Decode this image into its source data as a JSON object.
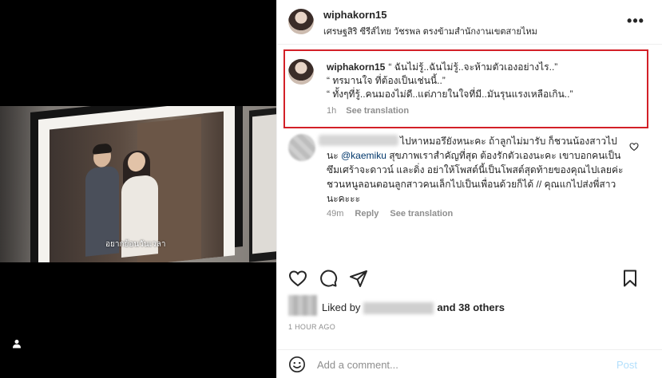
{
  "post": {
    "username": "wiphakorn15",
    "location": "เศรษฐสิริ ซีรีส์ไทย วัชรพล ตรงข้ามสำนักงานเขตสายไหม",
    "image_caption": "อยากย้อนวันเวลา"
  },
  "comments": [
    {
      "username": "wiphakorn15",
      "lines": [
        "“ ฉันไม่รู้..ฉันไม่รู้..จะห้ามตัวเองอย่างไร..”",
        "“ ทรมานใจ ที่ต้องเป็นเช่นนี้..”",
        "“ ทั้งๆที่รู้..คนมองไม่ดี..แต่ภายในใจที่มี..มันรุนแรงเหลือเกิน..”"
      ],
      "time": "1h",
      "see_translation": "See translation"
    },
    {
      "text_before_mention": "ไปหาหมอรึยังหนะคะ ถ้าลูกไม่มารับ ก็ชวนน้องสาวไปนะ",
      "mention": "@kaemiku",
      "text_after_mention": "สุขภาพเราสำคัญที่สุด ต้องรักตัวเองนะคะ เขาบอกคนเป็นซึมเศร้าจะดาวน์ และดิ่ง อย่าให้โพสต์นี้เป็นโพสต์สุดท้ายของคุณไปเลยค่ะ ชวนหนูลอนตอนลูกสาวคนเล็กไปเป็นเพื่อนด้วยก็ได้ // คุณแกไปส่งพี่สาวนะคะะะ",
      "time": "49m",
      "reply": "Reply",
      "see_translation": "See translation"
    }
  ],
  "likes": {
    "prefix": "Liked by",
    "others": "and 38 others"
  },
  "time_ago": "1 HOUR AGO",
  "add_comment": {
    "placeholder": "Add a comment...",
    "post_label": "Post"
  },
  "icons": [
    "more-icon",
    "heart-icon",
    "comment-icon",
    "share-icon",
    "bookmark-icon",
    "emoji-icon",
    "user-tag-icon"
  ],
  "colors": {
    "highlight_border": "#d32027",
    "mention": "#00376b",
    "post_button": "#b2dffc"
  }
}
